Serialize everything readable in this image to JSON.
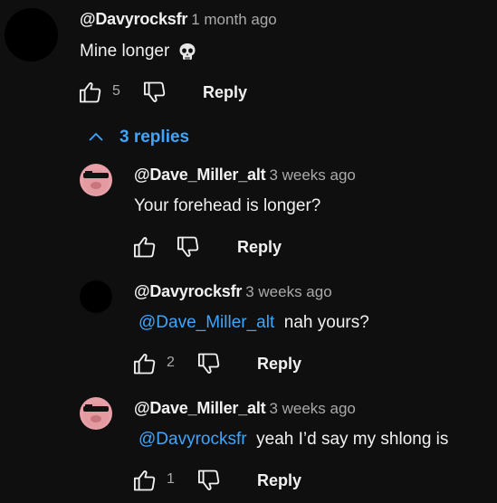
{
  "comment": {
    "author": "@Davyrocksfr",
    "time": "1 month ago",
    "text": "Mine longer",
    "likes": "5",
    "reply_label": "Reply",
    "emoji_icon": "skull-icon"
  },
  "replies_toggle": {
    "label": "3 replies",
    "icon": "chevron-up-icon"
  },
  "replies": [
    {
      "author": "@Dave_Miller_alt",
      "time": "3 weeks ago",
      "mention": "",
      "text": "Your forehead is longer?",
      "likes": "",
      "reply_label": "Reply"
    },
    {
      "author": "@Davyrocksfr",
      "time": "3 weeks ago",
      "mention": "@Dave_Miller_alt",
      "text": "nah yours?",
      "likes": "2",
      "reply_label": "Reply"
    },
    {
      "author": "@Dave_Miller_alt",
      "time": "3 weeks ago",
      "mention": "@Davyrocksfr",
      "text": "yeah I’d say my shlong is",
      "likes": "1",
      "reply_label": "Reply"
    }
  ],
  "colors": {
    "background": "#0f0f0f",
    "link_blue": "#3ea6ff",
    "muted": "#aaaaaa",
    "avatar_pink": "#e8a0a8"
  }
}
